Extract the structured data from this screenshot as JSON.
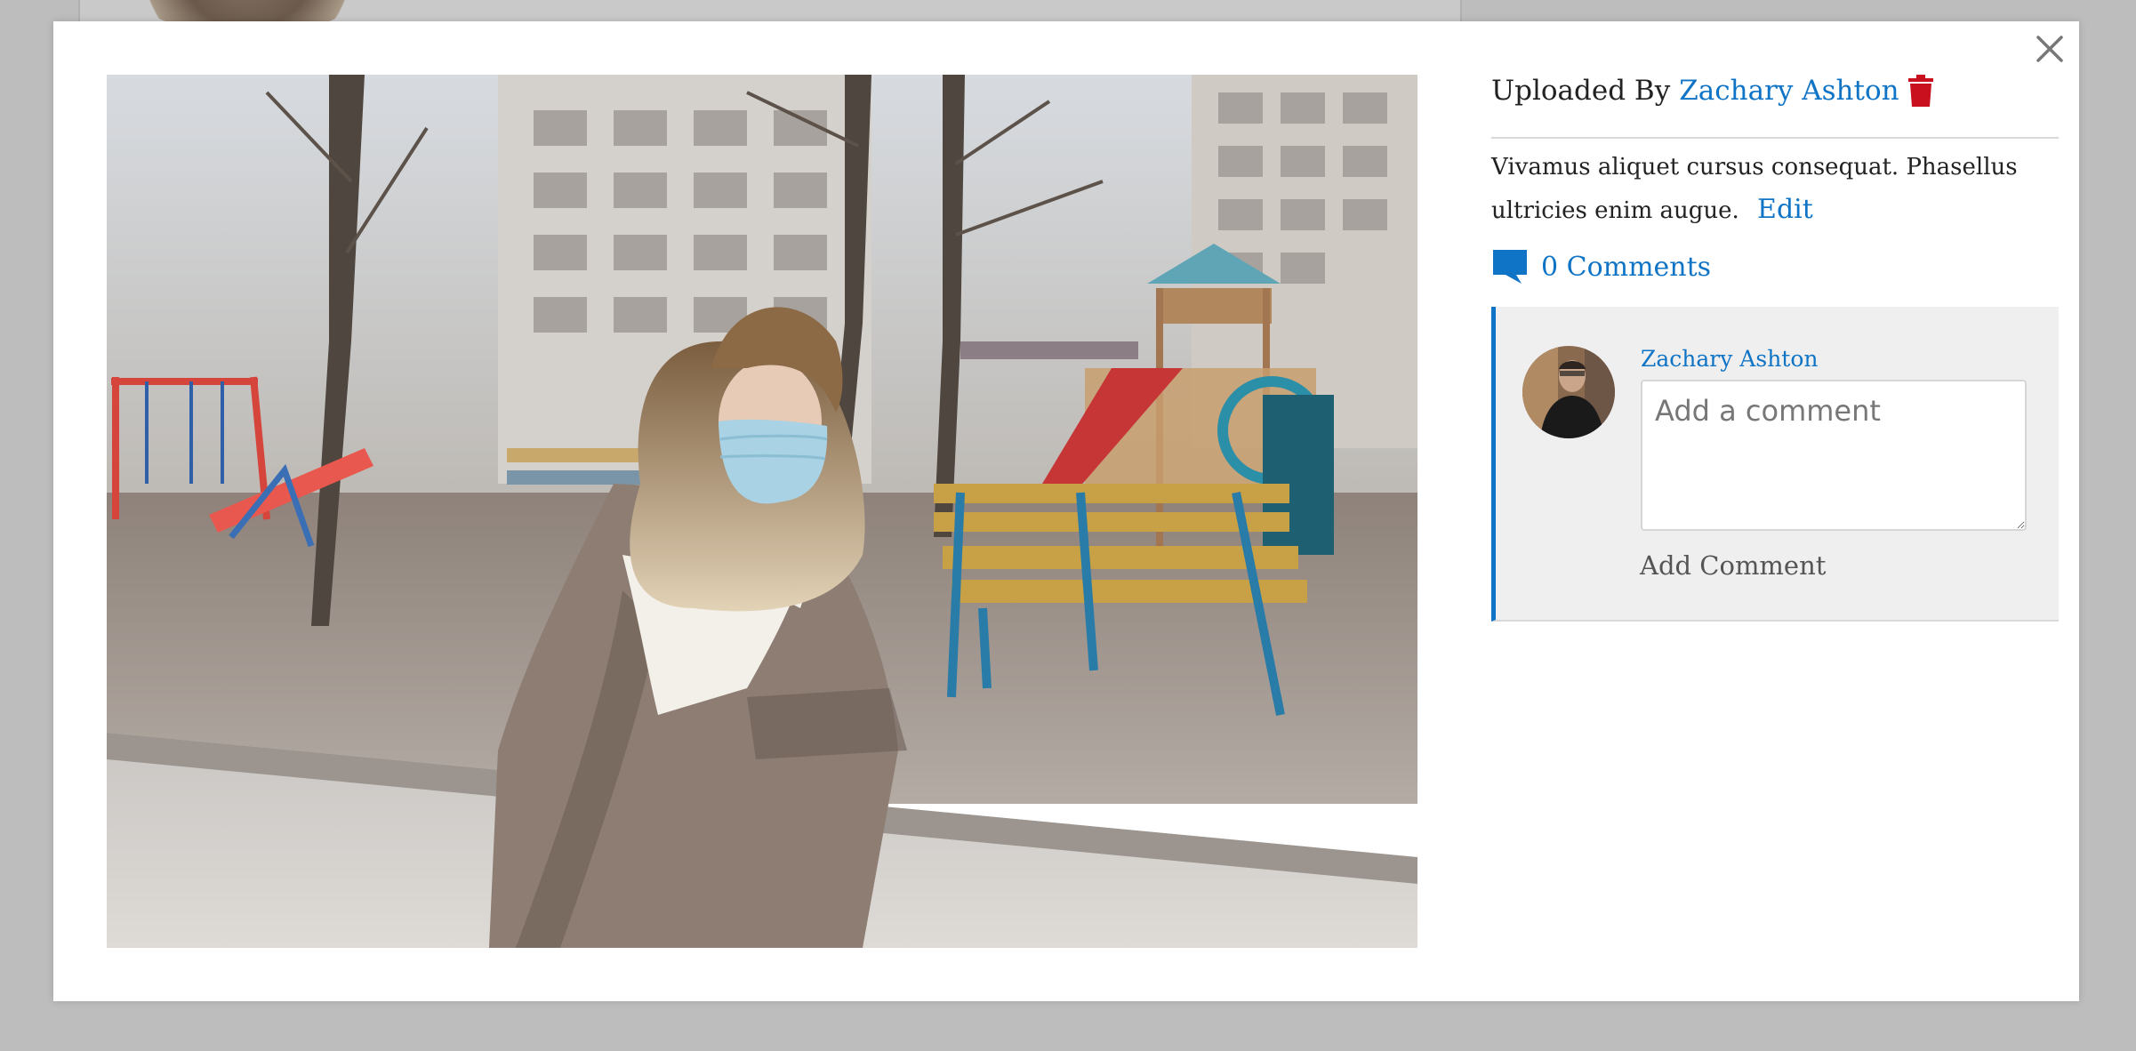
{
  "modal": {
    "uploaded_by_label": "Uploaded By",
    "uploader_name": "Zachary Ashton",
    "description": "Vivamus aliquet cursus consequat. Phasellus ultricies enim augue.",
    "edit_label": "Edit",
    "comments_label": "0 Comments",
    "close_icon": "close-icon",
    "trash_icon": "trash-icon",
    "comment_icon": "comment-icon"
  },
  "comment_form": {
    "user_name": "Zachary Ashton",
    "placeholder": "Add a comment",
    "value": "",
    "submit_label": "Add Comment"
  },
  "colors": {
    "link": "#0f74c5",
    "danger": "#c8101e",
    "overlay": "#bdbdbd",
    "panel": "#efefef"
  }
}
